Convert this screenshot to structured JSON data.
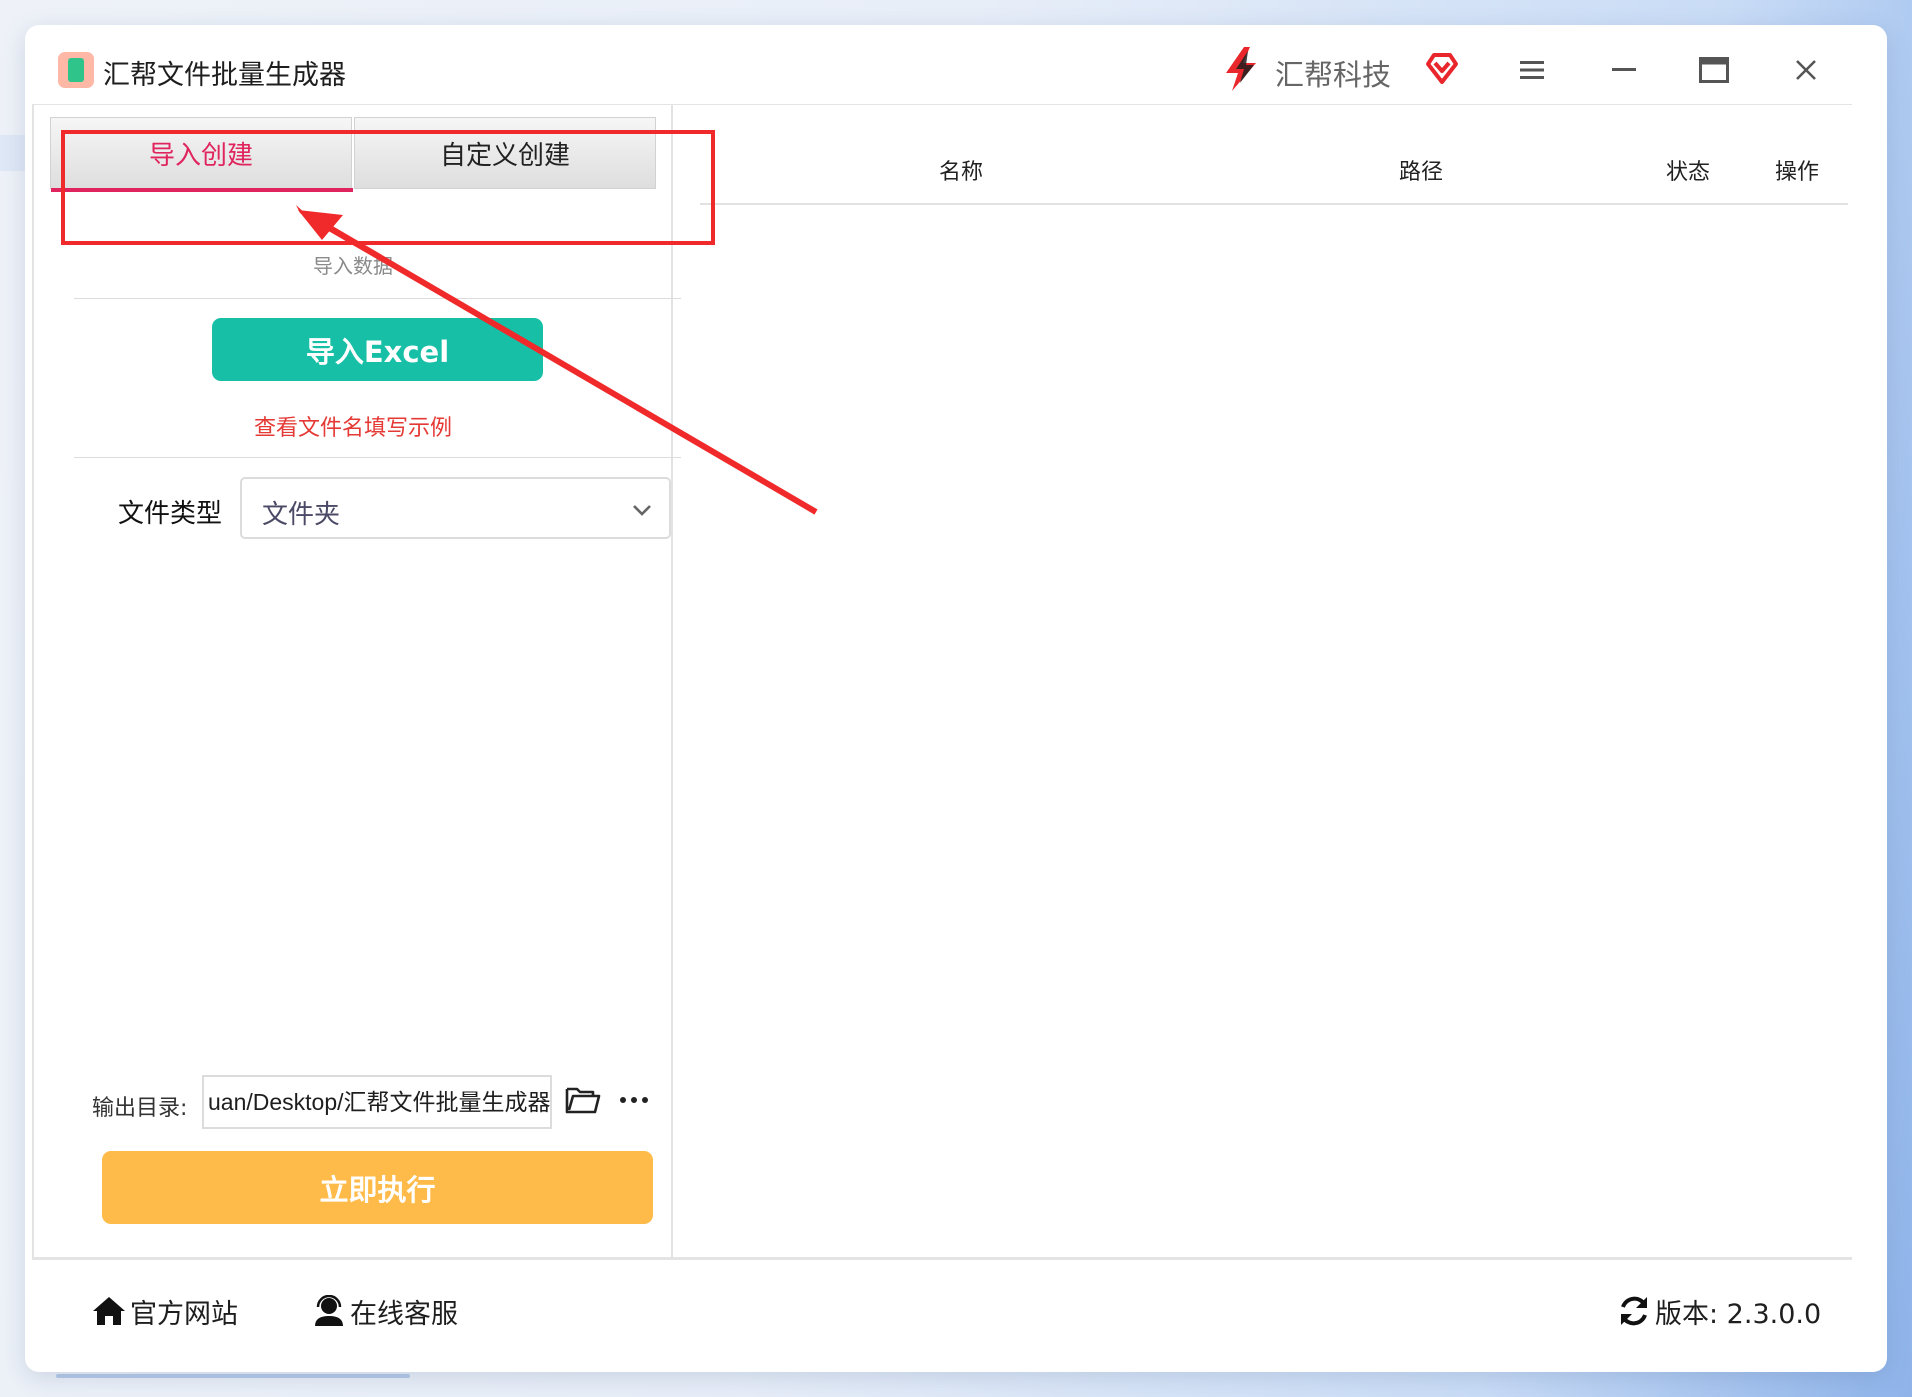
{
  "app": {
    "title": "汇帮文件批量生成器",
    "brand_name": "汇帮科技"
  },
  "window_controls": {
    "menu": "menu-icon",
    "minimize": "minimize-icon",
    "maximize": "maximize-icon",
    "close": "close-icon"
  },
  "tabs": [
    {
      "label": "导入创建",
      "active": true
    },
    {
      "label": "自定义创建",
      "active": false
    }
  ],
  "import_section": {
    "label": "导入数据",
    "import_button": "导入Excel",
    "example_link": "查看文件名填写示例"
  },
  "file_type": {
    "label": "文件类型",
    "value": "文件夹"
  },
  "output": {
    "label": "输出目录:",
    "value": "uan/Desktop/汇帮文件批量生成器"
  },
  "run_button": "立即执行",
  "table": {
    "columns": [
      "名称",
      "路径",
      "状态",
      "操作"
    ],
    "rows": []
  },
  "footer": {
    "website": "官方网站",
    "support": "在线客服",
    "version": "版本:  2.3.0.0"
  },
  "colors": {
    "accent_tab": "#e0245e",
    "excel_button": "#16bfa5",
    "run_button": "#ffbb4a",
    "link": "#e53935",
    "annotation": "#f02a2a"
  }
}
